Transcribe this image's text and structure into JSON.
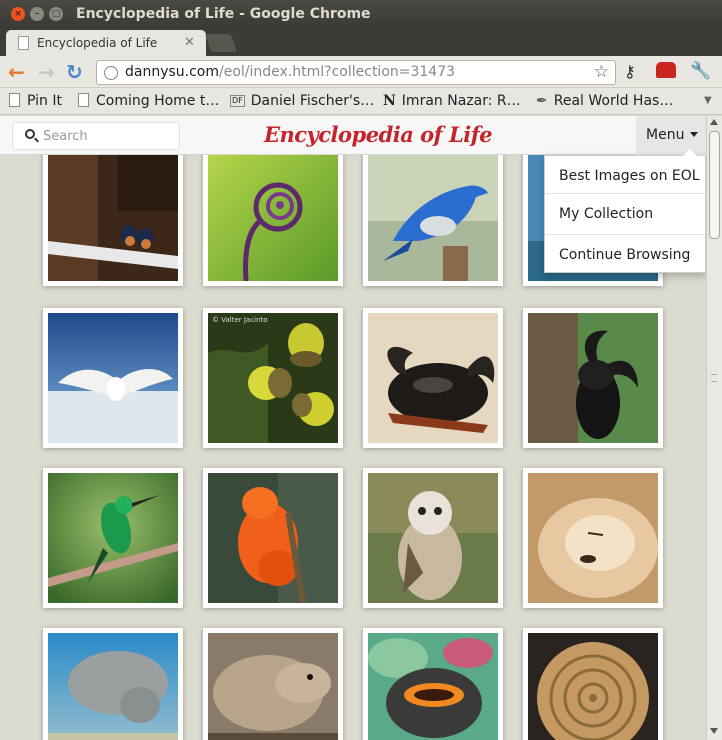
{
  "window": {
    "title": "Encyclopedia of Life - Google Chrome"
  },
  "tabs": [
    {
      "label": "Encyclopedia of Life"
    }
  ],
  "toolbar": {
    "url_host": "dannysu.com",
    "url_path": "/eol/index.html?collection=31473"
  },
  "bookmarks": [
    {
      "label": "Pin It",
      "icon": "page-icon"
    },
    {
      "label": "Coming Home t…",
      "icon": "page-icon"
    },
    {
      "label": "Daniel Fischer's…",
      "icon": "df-icon"
    },
    {
      "label": "Imran Nazar: R…",
      "icon": "n-icon"
    },
    {
      "label": "Real World Has…",
      "icon": "feather-icon"
    }
  ],
  "page": {
    "search_placeholder": "Search",
    "logo": "Encyclopedia of Life",
    "menu_label": "Menu",
    "menu_items": [
      "Best Images on EOL",
      "My Collection",
      "Continue Browsing"
    ]
  },
  "images": [
    {
      "subject": "barn-swallows"
    },
    {
      "subject": "fern-fiddlehead"
    },
    {
      "subject": "mountain-bluebird"
    },
    {
      "subject": "blue-water"
    },
    {
      "subject": "snowy-owl"
    },
    {
      "subject": "acorns",
      "caption": "© Valter Jacinto"
    },
    {
      "subject": "rhinoceros-beetle-1"
    },
    {
      "subject": "rhinoceros-beetle-2"
    },
    {
      "subject": "hummingbird"
    },
    {
      "subject": "cock-of-the-rock"
    },
    {
      "subject": "owl-chick"
    },
    {
      "subject": "fox-pup"
    },
    {
      "subject": "manatee"
    },
    {
      "subject": "rodent"
    },
    {
      "subject": "sea-creature"
    },
    {
      "subject": "ammonite-fossil"
    }
  ]
}
